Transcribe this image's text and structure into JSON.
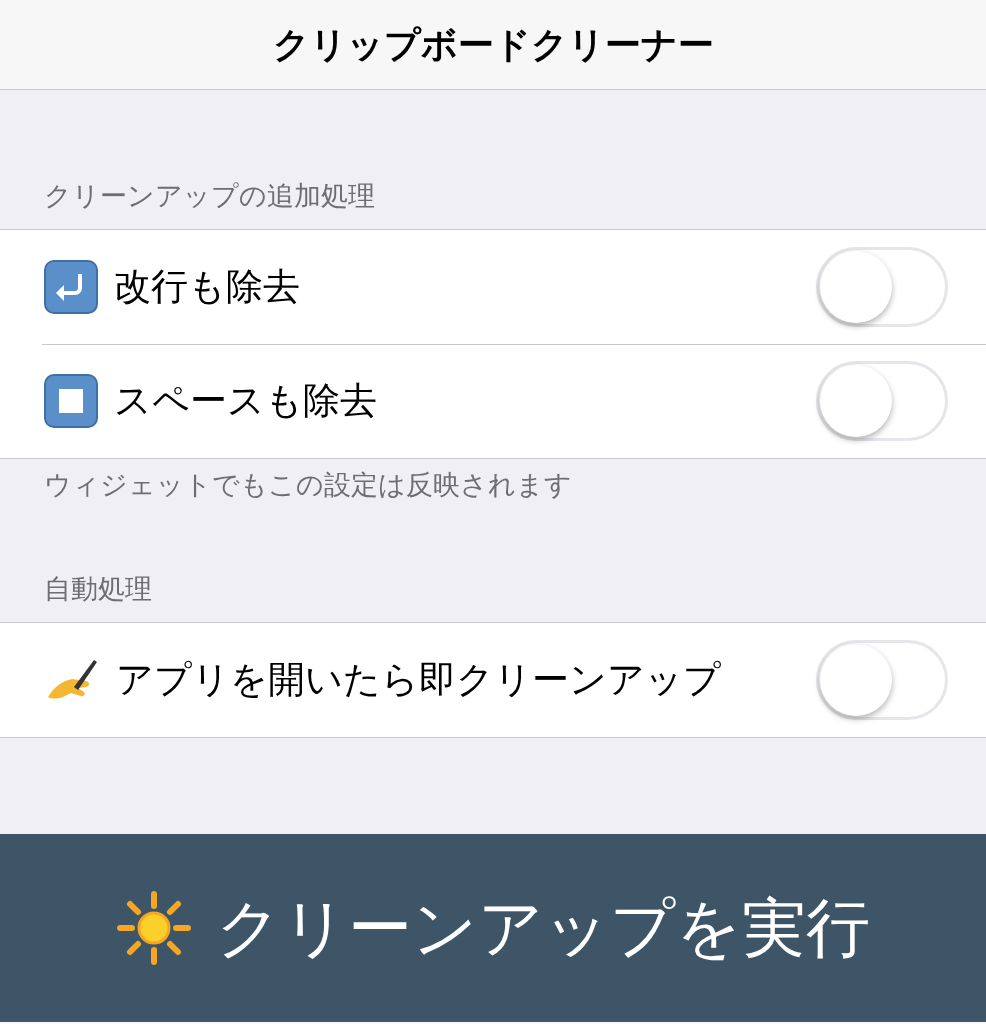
{
  "nav": {
    "title": "クリップボードクリーナー"
  },
  "sections": [
    {
      "header": "クリーンアップの追加処理",
      "footer": "ウィジェットでもこの設定は反映されます",
      "rows": [
        {
          "kind": "return",
          "label": "改行も除去",
          "on": false
        },
        {
          "kind": "stop",
          "label": "スペースも除去",
          "on": false
        }
      ]
    },
    {
      "header": "自動処理",
      "rows": [
        {
          "kind": "writing",
          "label": "アプリを開いたら即クリーンアップ",
          "on": false
        }
      ]
    }
  ],
  "action_button": {
    "kind": "sun",
    "label": "クリーンアップを実行"
  }
}
